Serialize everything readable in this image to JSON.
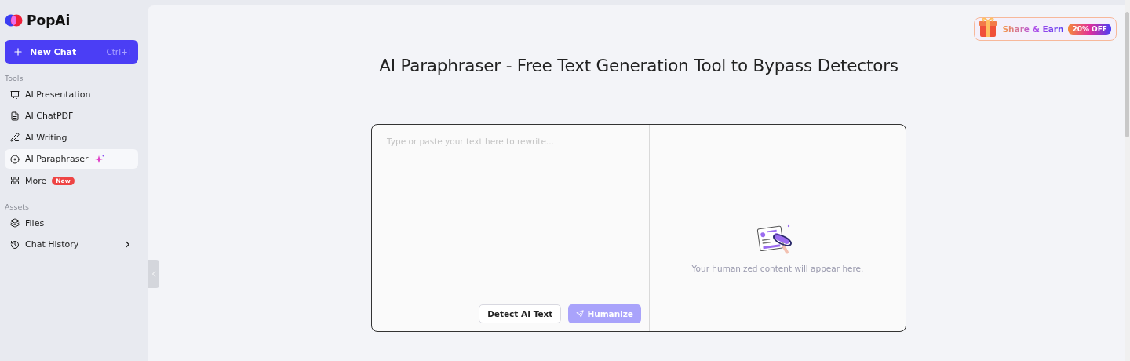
{
  "logo": {
    "name": "PopAi"
  },
  "new_chat": {
    "label": "New Chat",
    "shortcut": "Ctrl+I"
  },
  "sidebar": {
    "sections": [
      {
        "title": "Tools",
        "items": [
          {
            "label": "AI Presentation",
            "selected": false
          },
          {
            "label": "AI ChatPDF",
            "selected": false
          },
          {
            "label": "AI Writing",
            "selected": false
          },
          {
            "label": "AI Paraphraser",
            "selected": true
          },
          {
            "label": "More",
            "selected": false,
            "badge": "New"
          }
        ]
      },
      {
        "title": "Assets",
        "items": [
          {
            "label": "Files",
            "selected": false
          },
          {
            "label": "Chat History",
            "selected": false,
            "expanded": false
          }
        ]
      }
    ]
  },
  "promo": {
    "label": "Share & Earn",
    "badge": "20% OFF"
  },
  "page": {
    "title": "AI Paraphraser - Free Text Generation Tool to Bypass Detectors"
  },
  "editor": {
    "placeholder": "Type or paste your text here to rewrite...",
    "buttons": [
      {
        "label": "Detect AI Text",
        "kind": "outline",
        "disabled": false
      },
      {
        "label": "Humanize",
        "kind": "primary",
        "disabled": true
      }
    ]
  },
  "output": {
    "empty_text": "Your humanized content will appear here."
  }
}
